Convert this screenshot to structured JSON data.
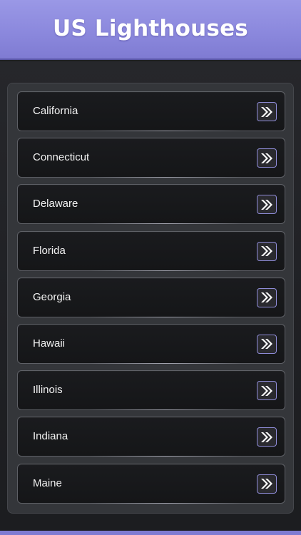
{
  "header": {
    "title": "US Lighthouses"
  },
  "colors": {
    "header_bg": "#8a87dc",
    "background": "#1e1f22",
    "item_bg": "#17181a",
    "accent": "#8f8cd8",
    "text": "#f2f2f2"
  },
  "list": {
    "items": [
      {
        "label": "California",
        "icon": "double-chevron-right-icon"
      },
      {
        "label": "Connecticut",
        "icon": "double-chevron-right-icon"
      },
      {
        "label": "Delaware",
        "icon": "double-chevron-right-icon"
      },
      {
        "label": "Florida",
        "icon": "double-chevron-right-icon"
      },
      {
        "label": "Georgia",
        "icon": "double-chevron-right-icon"
      },
      {
        "label": "Hawaii",
        "icon": "double-chevron-right-icon"
      },
      {
        "label": "Illinois",
        "icon": "double-chevron-right-icon"
      },
      {
        "label": "Indiana",
        "icon": "double-chevron-right-icon"
      },
      {
        "label": "Maine",
        "icon": "double-chevron-right-icon"
      }
    ]
  }
}
